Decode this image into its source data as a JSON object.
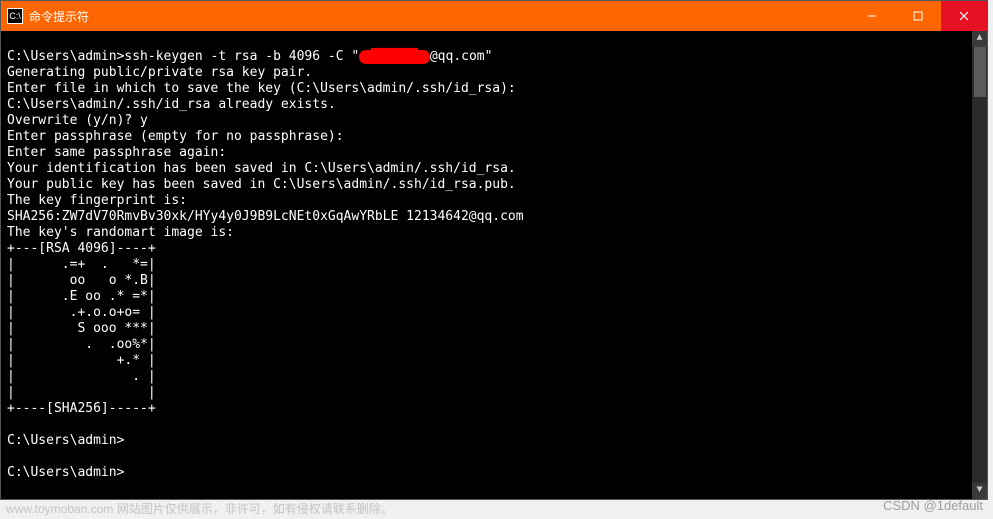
{
  "titlebar": {
    "icon_label": "C:\\",
    "title": "命令提示符"
  },
  "terminal": {
    "prompt1_prefix": "C:\\Users\\admin>",
    "cmd_pre": "ssh-keygen -t rsa -b 4096 -C \"",
    "redacted": "1██████2",
    "cmd_post": "@qq.com\"",
    "line_generating": "Generating public/private rsa key pair.",
    "line_enterfile": "Enter file in which to save the key (C:\\Users\\admin/.ssh/id_rsa):",
    "line_exists": "C:\\Users\\admin/.ssh/id_rsa already exists.",
    "line_overwrite": "Overwrite (y/n)? y",
    "line_passphrase": "Enter passphrase (empty for no passphrase):",
    "line_samepass": "Enter same passphrase again:",
    "line_idsaved": "Your identification has been saved in C:\\Users\\admin/.ssh/id_rsa.",
    "line_pubsaved": "Your public key has been saved in C:\\Users\\admin/.ssh/id_rsa.pub.",
    "line_fplabel": "The key fingerprint is:",
    "line_fp": "SHA256:ZW7dV70RmvBv30xk/HYy4y0J9B9LcNEt0xGqAwYRbLE 12134642@qq.com",
    "line_artlabel": "The key's randomart image is:",
    "art_top": "+---[RSA 4096]----+",
    "art_1": "|      .=+  .   *=|",
    "art_2": "|       oo   o *.B|",
    "art_3": "|      .E oo .* =*|",
    "art_4": "|       .+.o.o+o= |",
    "art_5": "|        S ooo ***|",
    "art_6": "|         .  .oo%*|",
    "art_7": "|             +.* |",
    "art_8": "|               . |",
    "art_9": "|                 |",
    "art_bot": "+----[SHA256]-----+",
    "blank": "",
    "prompt2": "C:\\Users\\admin>",
    "prompt3": "C:\\Users\\admin>"
  },
  "watermark": "CSDN @1default",
  "faded_background_text": "www.toymoban.com 网站图片仅供展示，非许可，如有侵权请联系删除。"
}
